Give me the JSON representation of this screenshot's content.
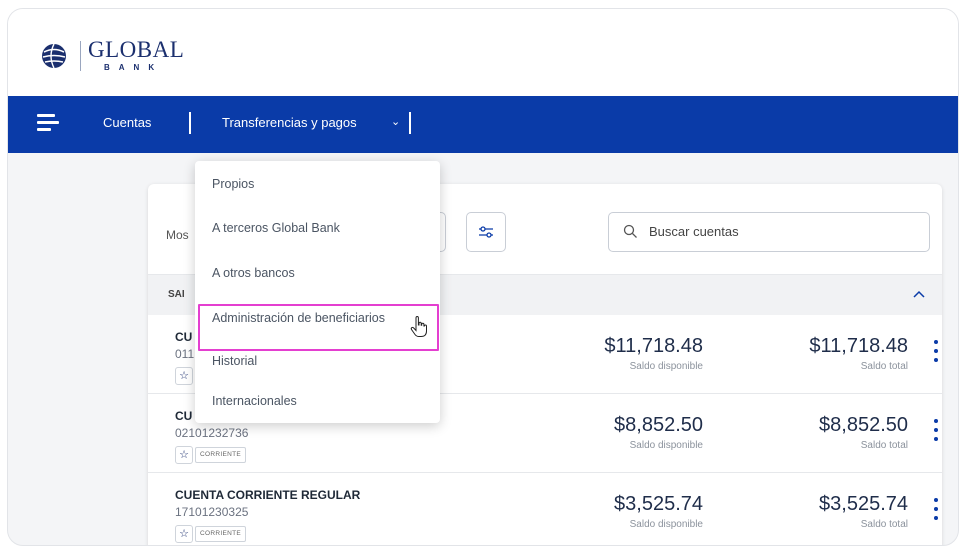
{
  "brand": {
    "name": "GLOBAL",
    "sub": "BANK"
  },
  "nav": {
    "cuentas": "Cuentas",
    "transferencias": "Transferencias y pagos"
  },
  "toolbar": {
    "mostrar_label": "Mos",
    "search_placeholder": "Buscar cuentas"
  },
  "section": {
    "label": "SAI"
  },
  "dropdown": {
    "items": [
      "Propios",
      "A terceros Global Bank",
      "A otros bancos",
      "Administración de beneficiarios",
      "Historial",
      "Internacionales"
    ],
    "highlighted_index": 3,
    "highlight_color": "#e43fd0"
  },
  "accounts": [
    {
      "name": "CU",
      "number": "011",
      "type": "",
      "available": "$11,718.48",
      "available_label": "Saldo disponible",
      "total": "$11,718.48",
      "total_label": "Saldo total"
    },
    {
      "name": "CU",
      "number": "02101232736",
      "type": "CORRIENTE",
      "available": "$8,852.50",
      "available_label": "Saldo disponible",
      "total": "$8,852.50",
      "total_label": "Saldo total"
    },
    {
      "name": "CUENTA CORRIENTE REGULAR",
      "number": "17101230325",
      "type": "CORRIENTE",
      "available": "$3,525.74",
      "available_label": "Saldo disponible",
      "total": "$3,525.74",
      "total_label": "Saldo total"
    }
  ],
  "colors": {
    "navbar": "#0a3ba8",
    "brand_text": "#1b2f6e",
    "accent": "#0a3ba8"
  }
}
